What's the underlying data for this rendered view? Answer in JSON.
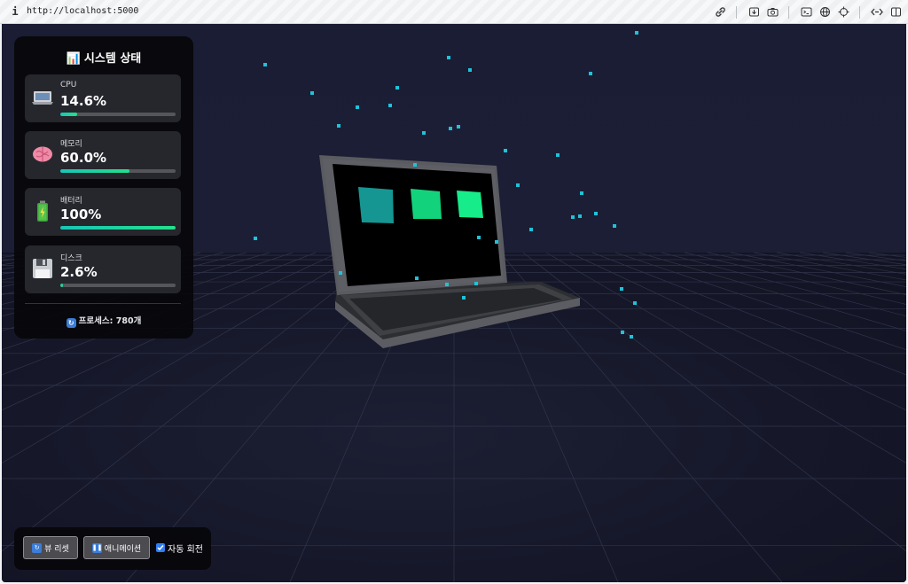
{
  "browser": {
    "url": "http://localhost:5000",
    "toolbar_icons": [
      "link-icon",
      "download-icon",
      "camera-icon",
      "terminal-icon",
      "globe-icon",
      "crosshair-icon",
      "code-icon",
      "split-view-icon"
    ]
  },
  "status_panel": {
    "title_emoji": "📊",
    "title": "시스템 상태",
    "cards": [
      {
        "icon": "laptop-icon",
        "label": "CPU",
        "value": "14.6%",
        "percent": 14.6
      },
      {
        "icon": "brain-icon",
        "label": "메모리",
        "value": "60.0%",
        "percent": 60.0
      },
      {
        "icon": "battery-icon",
        "label": "배터리",
        "value": "100%",
        "percent": 100
      },
      {
        "icon": "floppy-disk-icon",
        "label": "디스크",
        "value": "2.6%",
        "percent": 2.6
      }
    ],
    "process_text": "프로세스: 780개"
  },
  "controls": {
    "reset_view_label": "뷰 리셋",
    "animation_label": "애니메이션",
    "auto_rotate_label": "자동 회전",
    "auto_rotate_checked": true
  },
  "colors": {
    "accent_start": "#18c6b7",
    "accent_end": "#22e08a",
    "background": "#1b1d34",
    "particle": "#1ec3d8"
  }
}
